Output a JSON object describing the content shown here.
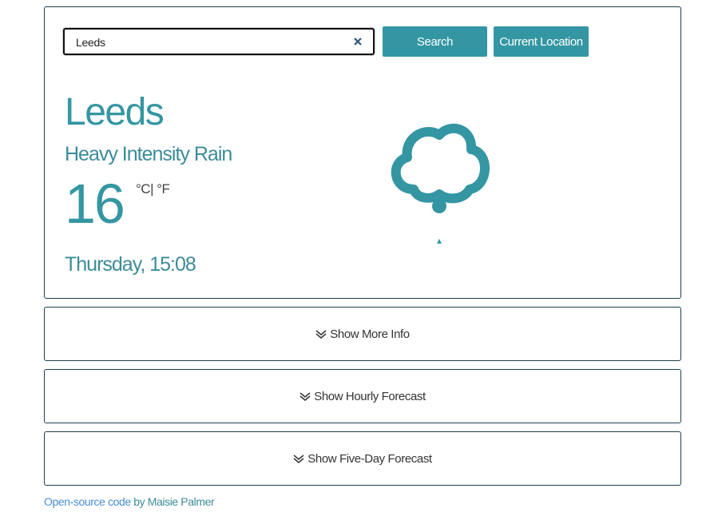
{
  "search": {
    "value": "Leeds",
    "button_label": "Search",
    "location_button_label": "Current Location"
  },
  "weather": {
    "city": "Leeds",
    "description": "Heavy Intensity Rain",
    "temperature": "16",
    "unit_c": "°C",
    "unit_separator": "|",
    "unit_f": "°F",
    "datetime": "Thursday, 15:08",
    "icon": "rain-cloud-icon"
  },
  "sections": {
    "more_info": "Show More Info",
    "hourly": "Show Hourly Forecast",
    "five_day": "Show Five-Day Forecast"
  },
  "footer": {
    "link_text": "Open-source code",
    "suffix": " by Maisie Palmer"
  },
  "colors": {
    "accent": "#3496a2",
    "text": "#3c8c99",
    "border": "#1e3f4f"
  }
}
